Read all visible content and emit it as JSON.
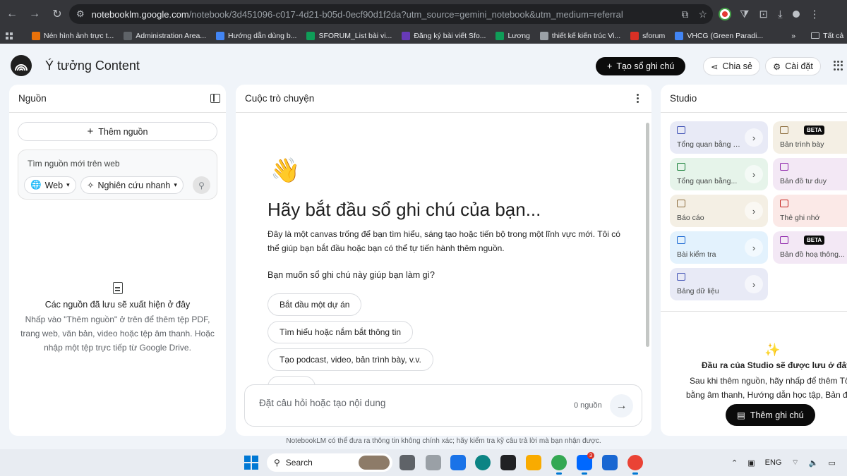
{
  "browser": {
    "url_host": "notebooklm.google.com",
    "url_path": "/notebook/3d451096-c017-4d21-b05d-0ecf90d1f2da?utm_source=gemini_notebook&utm_medium=referral",
    "bookmarks": [
      {
        "label": "Nén hình ảnh trực t...",
        "color": "#e8710a"
      },
      {
        "label": "Administration Area...",
        "color": "#5f6368"
      },
      {
        "label": "Hướng dẫn dùng b...",
        "color": "#4285f4"
      },
      {
        "label": "SFORUM_List bài vi...",
        "color": "#0f9d58"
      },
      {
        "label": "Đăng ký bài viết Sfo...",
        "color": "#673ab7"
      },
      {
        "label": "Lương",
        "color": "#0f9d58"
      },
      {
        "label": "thiết kế kiến trúc Vi...",
        "color": "#9aa0a6"
      },
      {
        "label": "sforum",
        "color": "#d93025"
      },
      {
        "label": "VHCG (Green Paradi...",
        "color": "#4285f4"
      }
    ],
    "bookmarks_overflow": "»",
    "all_bookmarks_label": "Tất cả"
  },
  "header": {
    "notebook_title": "Ý tưởng Content",
    "create_label": "Tạo sổ ghi chú",
    "share_label": "Chia sẻ",
    "settings_label": "Cài đặt"
  },
  "sources": {
    "title": "Nguồn",
    "add_label": "Thêm nguồn",
    "search_placeholder": "Tìm nguồn mới trên web",
    "web_chip": "Web",
    "research_chip": "Nghiên cứu nhanh",
    "empty_title": "Các nguồn đã lưu sẽ xuất hiện ở đây",
    "empty_desc": "Nhấp vào \"Thêm nguồn\" ở trên để thêm tệp PDF, trang web, văn bản, video hoặc tệp âm thanh. Hoặc nhập một tệp trực tiếp từ Google Drive."
  },
  "chat": {
    "title": "Cuộc trò chuyện",
    "emoji": "👋",
    "heading": "Hãy bắt đầu sổ ghi chú của bạn...",
    "intro": "Đây là một canvas trống để bạn tìm hiểu, sáng tạo hoặc tiến bộ trong một lĩnh vực mới. Tôi có thể giúp bạn bắt đầu hoặc bạn có thể tự tiến hành thêm nguồn.",
    "question": "Bạn muốn sổ ghi chú này giúp bạn làm gì?",
    "suggestions": [
      "Bắt đầu một dự án",
      "Tìm hiểu hoặc nắm bắt thông tin",
      "Tạo podcast, video, bản trình bày, v.v."
    ],
    "input_placeholder": "Đặt câu hỏi hoặc tạo nội dung",
    "source_count": "0 nguồn",
    "disclaimer": "NotebookLM có thể đưa ra thông tin không chính xác; hãy kiểm tra kỹ câu trả lời mà bạn nhận được."
  },
  "studio": {
    "title": "Studio",
    "tiles": [
      {
        "label": "Tổng quan bằng â...",
        "bg": "#e8eaf6",
        "icon_color": "#3f51b5",
        "arrow": true,
        "beta": false
      },
      {
        "label": "Bản trình bày",
        "bg": "#f4efe4",
        "icon_color": "#8d6e3f",
        "arrow": false,
        "beta": true,
        "beta_label": "BETA"
      },
      {
        "label": "Tổng quan bằng...",
        "bg": "#e6f4ea",
        "icon_color": "#188038",
        "arrow": true,
        "beta": false
      },
      {
        "label": "Bản đồ tư duy",
        "bg": "#f3e8f5",
        "icon_color": "#8e24aa",
        "arrow": false,
        "beta": false
      },
      {
        "label": "Báo cáo",
        "bg": "#f4efe4",
        "icon_color": "#8d6e3f",
        "arrow": true,
        "beta": false
      },
      {
        "label": "Thẻ ghi nhớ",
        "bg": "#fbe9e7",
        "icon_color": "#c5221f",
        "arrow": false,
        "beta": false
      },
      {
        "label": "Bài kiểm tra",
        "bg": "#e3f2fd",
        "icon_color": "#1967d2",
        "arrow": true,
        "beta": false
      },
      {
        "label": "Bản đồ hoạ thông...",
        "bg": "#f3e8f5",
        "icon_color": "#8e24aa",
        "arrow": false,
        "beta": true,
        "beta_label": "BETA"
      },
      {
        "label": "Bảng dữ liệu",
        "bg": "#e8eaf6",
        "icon_color": "#3f51b5",
        "arrow": true,
        "beta": false
      }
    ],
    "empty_title": "Đầu ra của Studio sẽ được lưu ở đây.",
    "empty_desc_line1": "Sau khi thêm nguồn, hãy nhấp để thêm Tổng q",
    "empty_desc_line2": "bằng âm thanh, Hướng dẫn học tập, Bản đồ tư d",
    "add_note_label": "Thêm ghi chú"
  },
  "taskbar": {
    "search_label": "Search",
    "language": "ENG",
    "zalo_badge": "3"
  }
}
